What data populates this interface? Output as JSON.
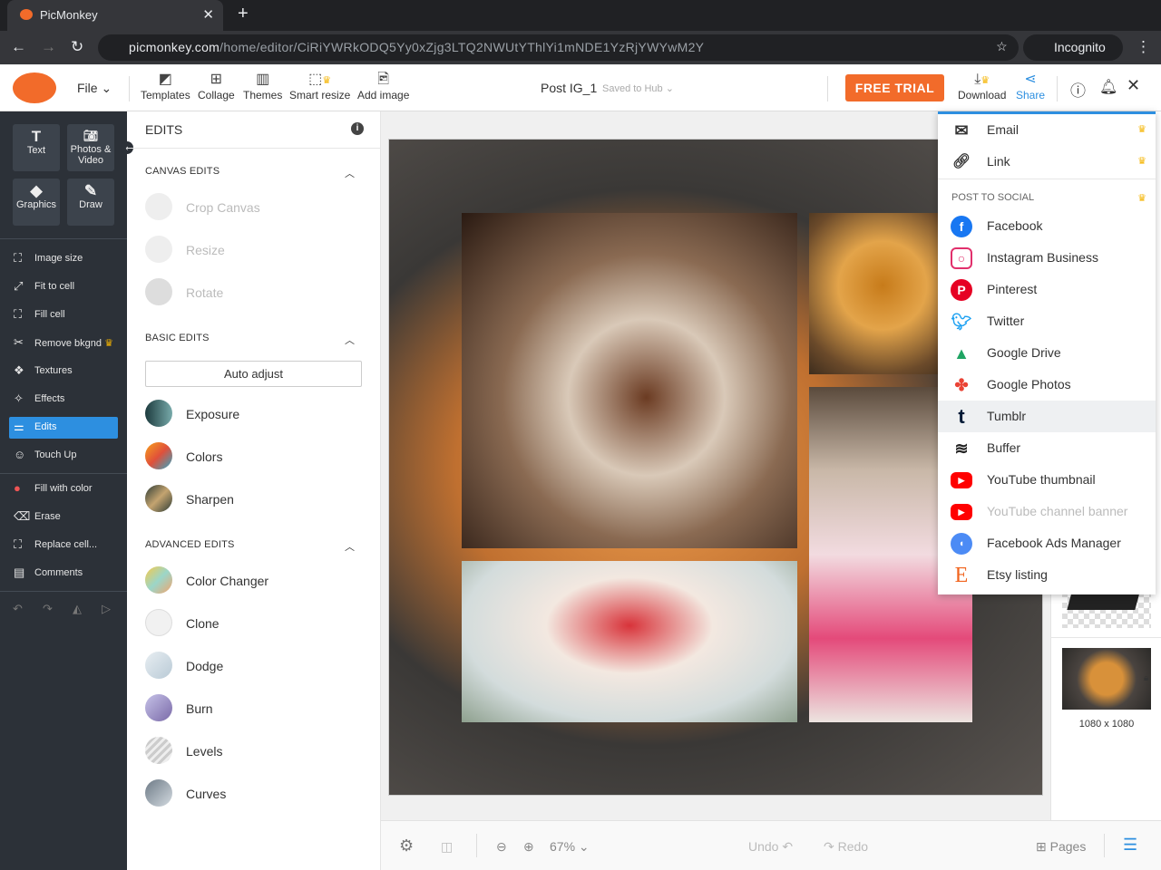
{
  "browser": {
    "tab_title": "PicMonkey",
    "url_host": "picmonkey.com",
    "url_path": "/home/editor/CiRiYWRkODQ5Yy0xZjg3LTQ2NWUtYThlYi1mNDE1YzRjYWYwM2Y",
    "profile": "Incognito"
  },
  "toolbar": {
    "file": "File",
    "items": [
      "Templates",
      "Collage",
      "Themes",
      "Smart resize",
      "Add image"
    ],
    "doc_title": "Post IG_1",
    "saved": "Saved to Hub",
    "free_trial": "FREE TRIAL",
    "download": "Download",
    "share": "Share"
  },
  "sidebar": {
    "big": [
      "Text",
      "Photos & Video",
      "Graphics",
      "Draw"
    ],
    "items": [
      "Image size",
      "Fit to cell",
      "Fill cell",
      "Remove bkgnd",
      "Textures",
      "Effects",
      "Edits",
      "Touch Up",
      "Fill with color",
      "Erase",
      "Replace cell...",
      "Comments"
    ]
  },
  "panel": {
    "title": "EDITS",
    "canvas_edits": "CANVAS EDITS",
    "canvas_items": [
      "Crop Canvas",
      "Resize",
      "Rotate"
    ],
    "basic_edits": "BASIC EDITS",
    "auto_adjust": "Auto adjust",
    "basic_items": [
      "Exposure",
      "Colors",
      "Sharpen"
    ],
    "advanced_edits": "ADVANCED EDITS",
    "advanced_items": [
      "Color Changer",
      "Clone",
      "Dodge",
      "Burn",
      "Levels",
      "Curves"
    ]
  },
  "share_menu": {
    "email": "Email",
    "link": "Link",
    "post_to_social": "POST TO SOCIAL",
    "items": [
      "Facebook",
      "Instagram Business",
      "Pinterest",
      "Twitter",
      "Google Drive",
      "Google Photos",
      "Tumblr",
      "Buffer",
      "YouTube thumbnail",
      "YouTube channel banner",
      "Facebook Ads Manager",
      "Etsy listing"
    ]
  },
  "right_panel": {
    "size": "1080 x 1080"
  },
  "bottom": {
    "zoom": "67%",
    "undo": "Undo",
    "redo": "Redo",
    "pages": "Pages"
  },
  "colors": {
    "accent": "#f26b2a",
    "active": "#2d8fe0"
  }
}
